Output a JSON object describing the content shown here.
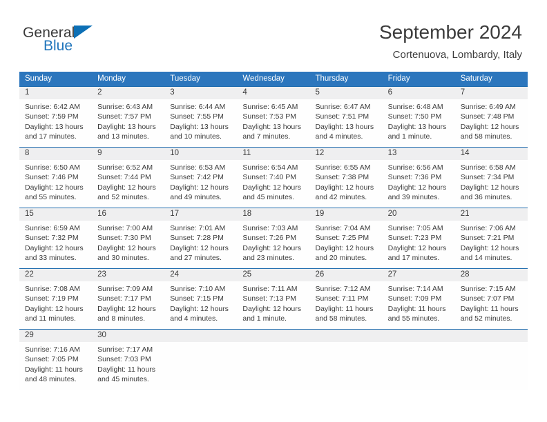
{
  "brand": {
    "name_top": "General",
    "name_bottom": "Blue",
    "triangle_icon": "triangle-logo-icon",
    "accent_color": "#0c6fb5"
  },
  "header": {
    "title": "September 2024",
    "subtitle": "Cortenuova, Lombardy, Italy"
  },
  "colors": {
    "header_row_blue": "#2c76bd",
    "date_strip_gray": "#efeff0",
    "date_strip_border_blue": "#1f6cae",
    "text": "#3b3b3b",
    "brand_blue": "#1f74bb"
  },
  "calendar": {
    "day_headers": [
      "Sunday",
      "Monday",
      "Tuesday",
      "Wednesday",
      "Thursday",
      "Friday",
      "Saturday"
    ],
    "weeks": [
      {
        "dates": [
          "1",
          "2",
          "3",
          "4",
          "5",
          "6",
          "7"
        ],
        "cells": [
          {
            "sunrise": "Sunrise: 6:42 AM",
            "sunset": "Sunset: 7:59 PM",
            "daylight_1": "Daylight: 13 hours",
            "daylight_2": "and 17 minutes."
          },
          {
            "sunrise": "Sunrise: 6:43 AM",
            "sunset": "Sunset: 7:57 PM",
            "daylight_1": "Daylight: 13 hours",
            "daylight_2": "and 13 minutes."
          },
          {
            "sunrise": "Sunrise: 6:44 AM",
            "sunset": "Sunset: 7:55 PM",
            "daylight_1": "Daylight: 13 hours",
            "daylight_2": "and 10 minutes."
          },
          {
            "sunrise": "Sunrise: 6:45 AM",
            "sunset": "Sunset: 7:53 PM",
            "daylight_1": "Daylight: 13 hours",
            "daylight_2": "and 7 minutes."
          },
          {
            "sunrise": "Sunrise: 6:47 AM",
            "sunset": "Sunset: 7:51 PM",
            "daylight_1": "Daylight: 13 hours",
            "daylight_2": "and 4 minutes."
          },
          {
            "sunrise": "Sunrise: 6:48 AM",
            "sunset": "Sunset: 7:50 PM",
            "daylight_1": "Daylight: 13 hours",
            "daylight_2": "and 1 minute."
          },
          {
            "sunrise": "Sunrise: 6:49 AM",
            "sunset": "Sunset: 7:48 PM",
            "daylight_1": "Daylight: 12 hours",
            "daylight_2": "and 58 minutes."
          }
        ]
      },
      {
        "dates": [
          "8",
          "9",
          "10",
          "11",
          "12",
          "13",
          "14"
        ],
        "cells": [
          {
            "sunrise": "Sunrise: 6:50 AM",
            "sunset": "Sunset: 7:46 PM",
            "daylight_1": "Daylight: 12 hours",
            "daylight_2": "and 55 minutes."
          },
          {
            "sunrise": "Sunrise: 6:52 AM",
            "sunset": "Sunset: 7:44 PM",
            "daylight_1": "Daylight: 12 hours",
            "daylight_2": "and 52 minutes."
          },
          {
            "sunrise": "Sunrise: 6:53 AM",
            "sunset": "Sunset: 7:42 PM",
            "daylight_1": "Daylight: 12 hours",
            "daylight_2": "and 49 minutes."
          },
          {
            "sunrise": "Sunrise: 6:54 AM",
            "sunset": "Sunset: 7:40 PM",
            "daylight_1": "Daylight: 12 hours",
            "daylight_2": "and 45 minutes."
          },
          {
            "sunrise": "Sunrise: 6:55 AM",
            "sunset": "Sunset: 7:38 PM",
            "daylight_1": "Daylight: 12 hours",
            "daylight_2": "and 42 minutes."
          },
          {
            "sunrise": "Sunrise: 6:56 AM",
            "sunset": "Sunset: 7:36 PM",
            "daylight_1": "Daylight: 12 hours",
            "daylight_2": "and 39 minutes."
          },
          {
            "sunrise": "Sunrise: 6:58 AM",
            "sunset": "Sunset: 7:34 PM",
            "daylight_1": "Daylight: 12 hours",
            "daylight_2": "and 36 minutes."
          }
        ]
      },
      {
        "dates": [
          "15",
          "16",
          "17",
          "18",
          "19",
          "20",
          "21"
        ],
        "cells": [
          {
            "sunrise": "Sunrise: 6:59 AM",
            "sunset": "Sunset: 7:32 PM",
            "daylight_1": "Daylight: 12 hours",
            "daylight_2": "and 33 minutes."
          },
          {
            "sunrise": "Sunrise: 7:00 AM",
            "sunset": "Sunset: 7:30 PM",
            "daylight_1": "Daylight: 12 hours",
            "daylight_2": "and 30 minutes."
          },
          {
            "sunrise": "Sunrise: 7:01 AM",
            "sunset": "Sunset: 7:28 PM",
            "daylight_1": "Daylight: 12 hours",
            "daylight_2": "and 27 minutes."
          },
          {
            "sunrise": "Sunrise: 7:03 AM",
            "sunset": "Sunset: 7:26 PM",
            "daylight_1": "Daylight: 12 hours",
            "daylight_2": "and 23 minutes."
          },
          {
            "sunrise": "Sunrise: 7:04 AM",
            "sunset": "Sunset: 7:25 PM",
            "daylight_1": "Daylight: 12 hours",
            "daylight_2": "and 20 minutes."
          },
          {
            "sunrise": "Sunrise: 7:05 AM",
            "sunset": "Sunset: 7:23 PM",
            "daylight_1": "Daylight: 12 hours",
            "daylight_2": "and 17 minutes."
          },
          {
            "sunrise": "Sunrise: 7:06 AM",
            "sunset": "Sunset: 7:21 PM",
            "daylight_1": "Daylight: 12 hours",
            "daylight_2": "and 14 minutes."
          }
        ]
      },
      {
        "dates": [
          "22",
          "23",
          "24",
          "25",
          "26",
          "27",
          "28"
        ],
        "cells": [
          {
            "sunrise": "Sunrise: 7:08 AM",
            "sunset": "Sunset: 7:19 PM",
            "daylight_1": "Daylight: 12 hours",
            "daylight_2": "and 11 minutes."
          },
          {
            "sunrise": "Sunrise: 7:09 AM",
            "sunset": "Sunset: 7:17 PM",
            "daylight_1": "Daylight: 12 hours",
            "daylight_2": "and 8 minutes."
          },
          {
            "sunrise": "Sunrise: 7:10 AM",
            "sunset": "Sunset: 7:15 PM",
            "daylight_1": "Daylight: 12 hours",
            "daylight_2": "and 4 minutes."
          },
          {
            "sunrise": "Sunrise: 7:11 AM",
            "sunset": "Sunset: 7:13 PM",
            "daylight_1": "Daylight: 12 hours",
            "daylight_2": "and 1 minute."
          },
          {
            "sunrise": "Sunrise: 7:12 AM",
            "sunset": "Sunset: 7:11 PM",
            "daylight_1": "Daylight: 11 hours",
            "daylight_2": "and 58 minutes."
          },
          {
            "sunrise": "Sunrise: 7:14 AM",
            "sunset": "Sunset: 7:09 PM",
            "daylight_1": "Daylight: 11 hours",
            "daylight_2": "and 55 minutes."
          },
          {
            "sunrise": "Sunrise: 7:15 AM",
            "sunset": "Sunset: 7:07 PM",
            "daylight_1": "Daylight: 11 hours",
            "daylight_2": "and 52 minutes."
          }
        ]
      },
      {
        "dates": [
          "29",
          "30",
          "",
          "",
          "",
          "",
          ""
        ],
        "cells": [
          {
            "sunrise": "Sunrise: 7:16 AM",
            "sunset": "Sunset: 7:05 PM",
            "daylight_1": "Daylight: 11 hours",
            "daylight_2": "and 48 minutes."
          },
          {
            "sunrise": "Sunrise: 7:17 AM",
            "sunset": "Sunset: 7:03 PM",
            "daylight_1": "Daylight: 11 hours",
            "daylight_2": "and 45 minutes."
          },
          {
            "sunrise": "",
            "sunset": "",
            "daylight_1": "",
            "daylight_2": ""
          },
          {
            "sunrise": "",
            "sunset": "",
            "daylight_1": "",
            "daylight_2": ""
          },
          {
            "sunrise": "",
            "sunset": "",
            "daylight_1": "",
            "daylight_2": ""
          },
          {
            "sunrise": "",
            "sunset": "",
            "daylight_1": "",
            "daylight_2": ""
          },
          {
            "sunrise": "",
            "sunset": "",
            "daylight_1": "",
            "daylight_2": ""
          }
        ]
      }
    ]
  }
}
